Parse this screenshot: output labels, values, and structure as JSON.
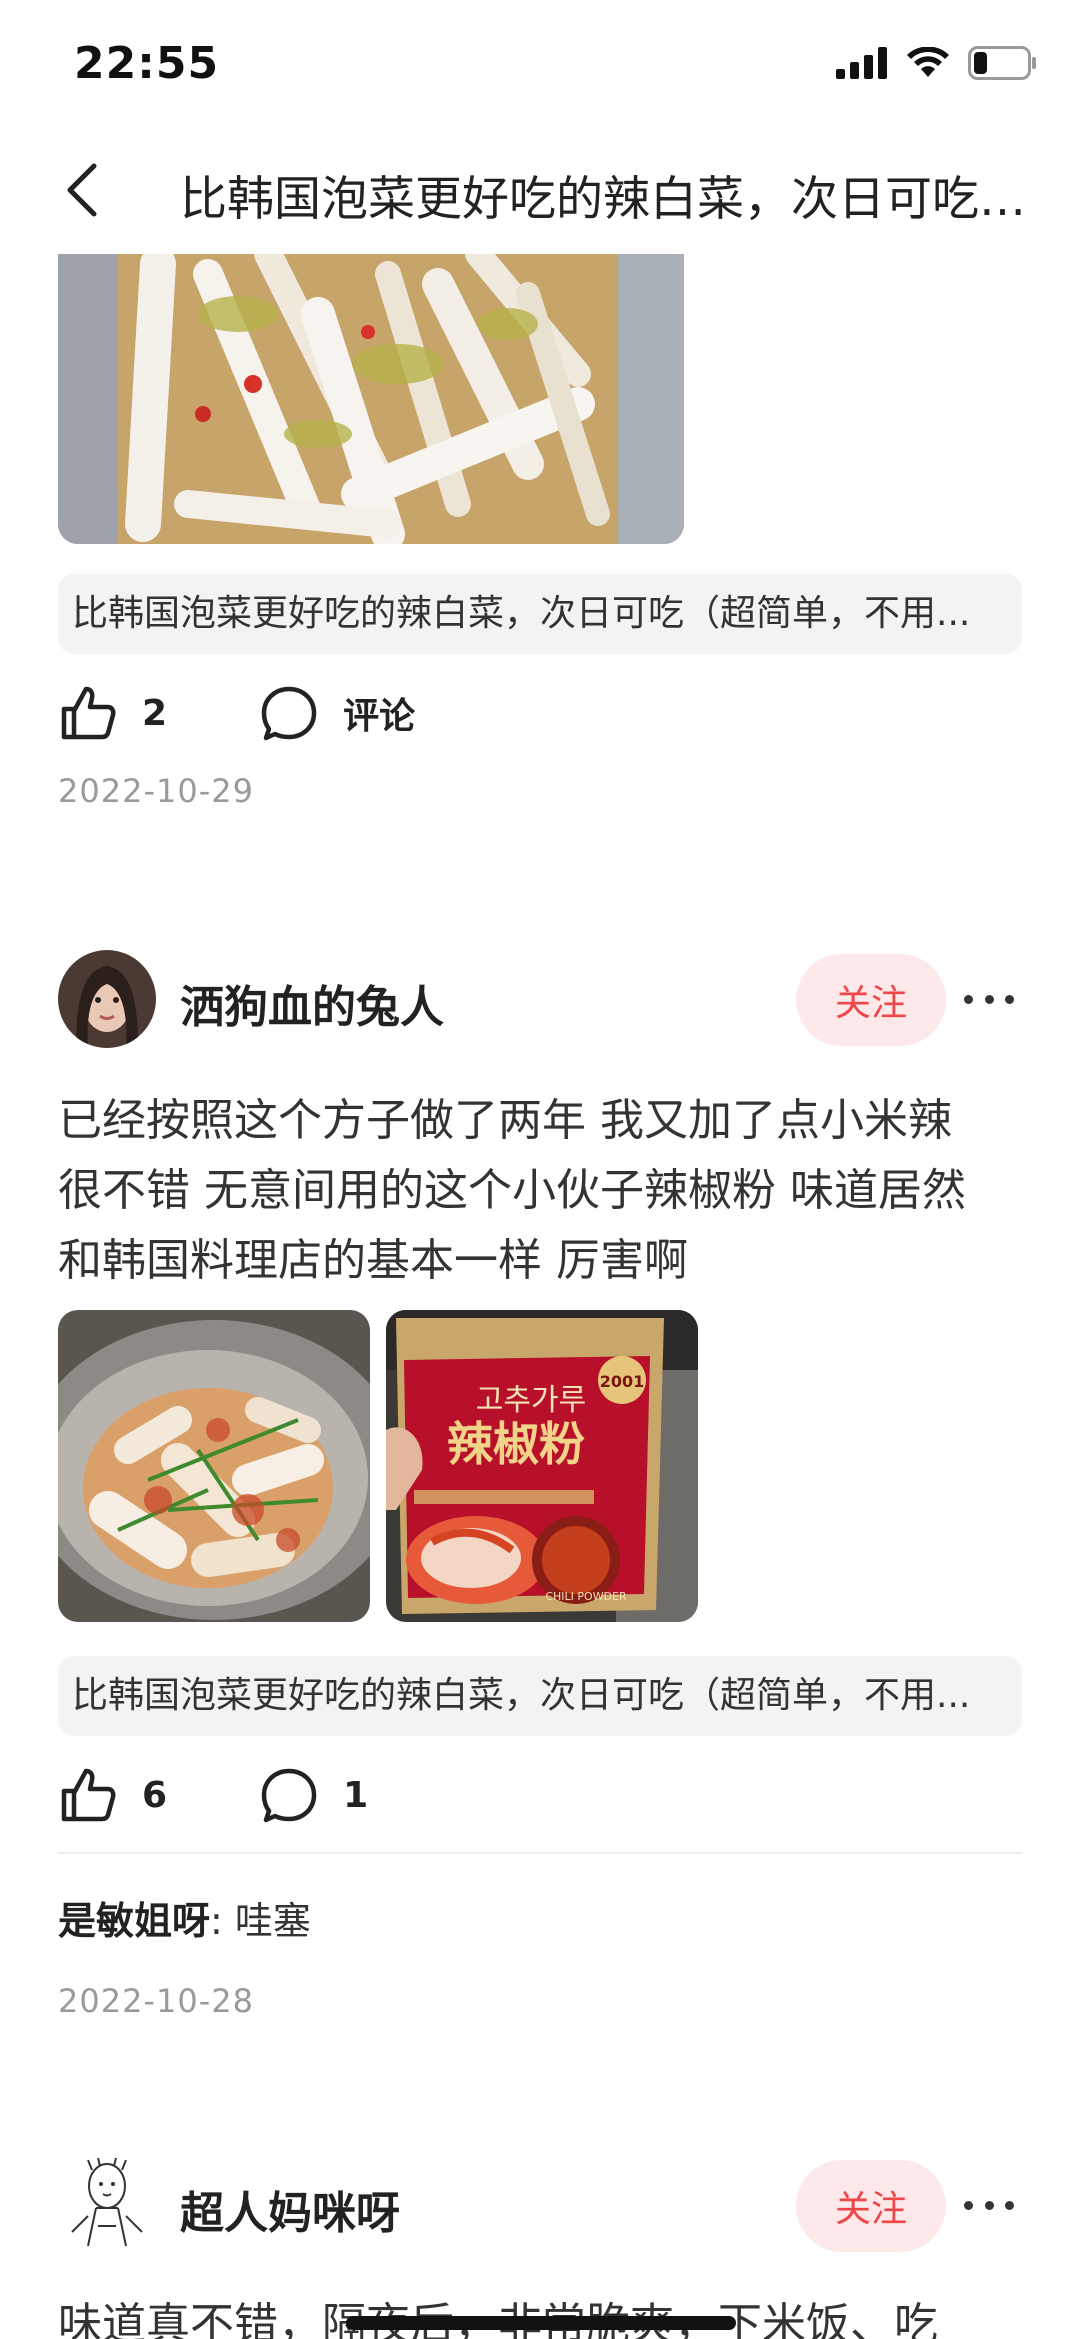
{
  "status": {
    "time": "22:55",
    "battery_fill": 0.25
  },
  "nav": {
    "title": "比韩国泡菜更好吃的辣白菜，次日可吃（超简单，不用..."
  },
  "post1": {
    "ref_text": "比韩国泡菜更好吃的辣白菜，次日可吃（超简单，不用...",
    "likes": "2",
    "comment_label": "评论",
    "date": "2022-10-29"
  },
  "post2": {
    "username": "洒狗血的兔人",
    "follow_label": "关注",
    "text_lines": [
      "已经按照这个方子做了两年 我又加了点小米辣",
      "很不错 无意间用的这个小伙子辣椒粉 味道居然",
      "和韩国料理店的基本一样 厉害啊"
    ],
    "package_text": {
      "korean": "고추가루",
      "chinese": "辣椒粉",
      "badge": "2001",
      "english": "CHILI POWDER"
    },
    "ref_text": "比韩国泡菜更好吃的辣白菜，次日可吃（超简单，不用...",
    "likes": "6",
    "comments": "1",
    "reply": {
      "name": "是敏姐呀",
      "text": ": 哇塞"
    },
    "date": "2022-10-28"
  },
  "post3": {
    "username": "超人妈咪呀",
    "follow_label": "关注",
    "text_preview": "味道真不错，隔夜后，非常脆爽，下米饭、吃"
  },
  "colors": {
    "accent": "#f0464a",
    "follow_bg": "#fde9e9",
    "ref_bg": "#f3f3f3"
  }
}
